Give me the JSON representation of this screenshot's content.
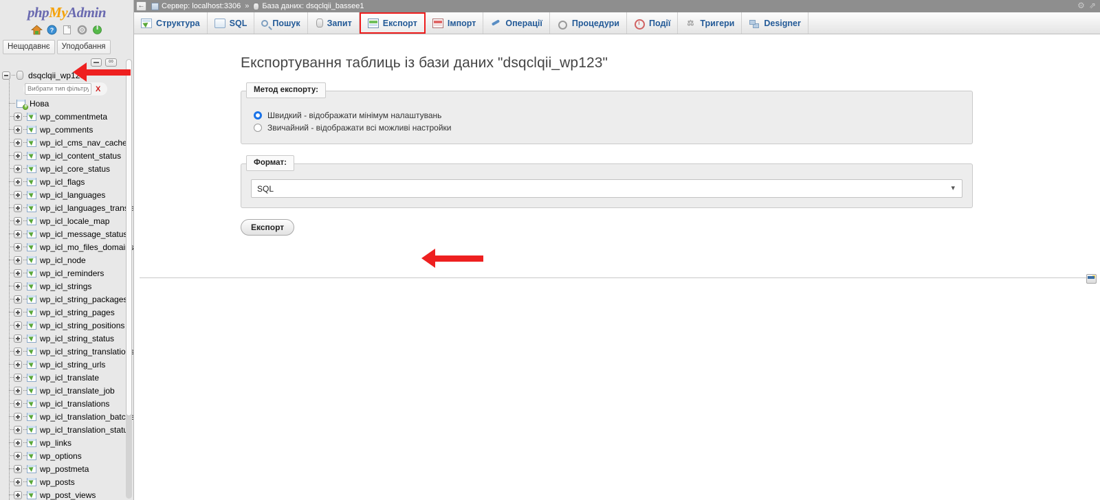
{
  "brand": {
    "php": "php",
    "my": "My",
    "admin": "Admin",
    "icons": [
      {
        "name": "home-icon",
        "glyph": "⌂"
      },
      {
        "name": "help-icon",
        "glyph": "?"
      },
      {
        "name": "docs-icon",
        "glyph": "❐"
      },
      {
        "name": "settings-icon",
        "glyph": "⚙"
      },
      {
        "name": "logout-icon",
        "glyph": "↻"
      }
    ]
  },
  "sidebar": {
    "tabs": [
      {
        "label": "Нещодавнє"
      },
      {
        "label": "Уподобання"
      }
    ],
    "filter": {
      "placeholder": "Вибрати тип фільтру, Ен",
      "value": "",
      "clear_label": "X"
    },
    "database": "dsqclqii_wp123",
    "new_item": "Нова",
    "tables": [
      "wp_commentmeta",
      "wp_comments",
      "wp_icl_cms_nav_cache",
      "wp_icl_content_status",
      "wp_icl_core_status",
      "wp_icl_flags",
      "wp_icl_languages",
      "wp_icl_languages_translat",
      "wp_icl_locale_map",
      "wp_icl_message_status",
      "wp_icl_mo_files_domains",
      "wp_icl_node",
      "wp_icl_reminders",
      "wp_icl_strings",
      "wp_icl_string_packages",
      "wp_icl_string_pages",
      "wp_icl_string_positions",
      "wp_icl_string_status",
      "wp_icl_string_translations",
      "wp_icl_string_urls",
      "wp_icl_translate",
      "wp_icl_translate_job",
      "wp_icl_translations",
      "wp_icl_translation_batches",
      "wp_icl_translation_status",
      "wp_links",
      "wp_options",
      "wp_postmeta",
      "wp_posts",
      "wp_post_views"
    ]
  },
  "breadcrumb": {
    "back_label": "←",
    "server": "Сервер: localhost:3306",
    "separator": "»",
    "database": "База даних: dsqclqii_bassee1"
  },
  "tabs": [
    {
      "label": "Структура",
      "icon": "structure-icon",
      "active": false
    },
    {
      "label": "SQL",
      "icon": "sql-icon",
      "active": false
    },
    {
      "label": "Пошук",
      "icon": "search-icon",
      "active": false
    },
    {
      "label": "Запит",
      "icon": "query-icon",
      "active": false
    },
    {
      "label": "Експорт",
      "icon": "export-icon",
      "active": true
    },
    {
      "label": "Імпорт",
      "icon": "import-icon",
      "active": false
    },
    {
      "label": "Операції",
      "icon": "operations-icon",
      "active": false
    },
    {
      "label": "Процедури",
      "icon": "procedures-icon",
      "active": false
    },
    {
      "label": "Події",
      "icon": "events-icon",
      "active": false
    },
    {
      "label": "Тригери",
      "icon": "triggers-icon",
      "active": false
    },
    {
      "label": "Designer",
      "icon": "designer-icon",
      "active": false
    }
  ],
  "main": {
    "page_title": "Експортування таблиць із бази даних \"dsqclqii_wp123\"",
    "method": {
      "legend": "Метод експорту:",
      "options": [
        {
          "label": "Швидкий - відображати мінімум налаштувань",
          "checked": true
        },
        {
          "label": "Звичайний - відображати всі можливі настройки",
          "checked": false
        }
      ]
    },
    "format": {
      "legend": "Формат:",
      "selected": "SQL"
    },
    "export_button": "Експорт"
  },
  "topright": {
    "settings_glyph": "⚙",
    "collapse_glyph": "⇗"
  },
  "colors": {
    "accent_red": "#ee1c1c",
    "link_blue": "#235a97",
    "radio_blue": "#1a73e8",
    "breadcrumb_bg": "#8e8e8e",
    "sidebar_bg": "#e8e8e8"
  }
}
